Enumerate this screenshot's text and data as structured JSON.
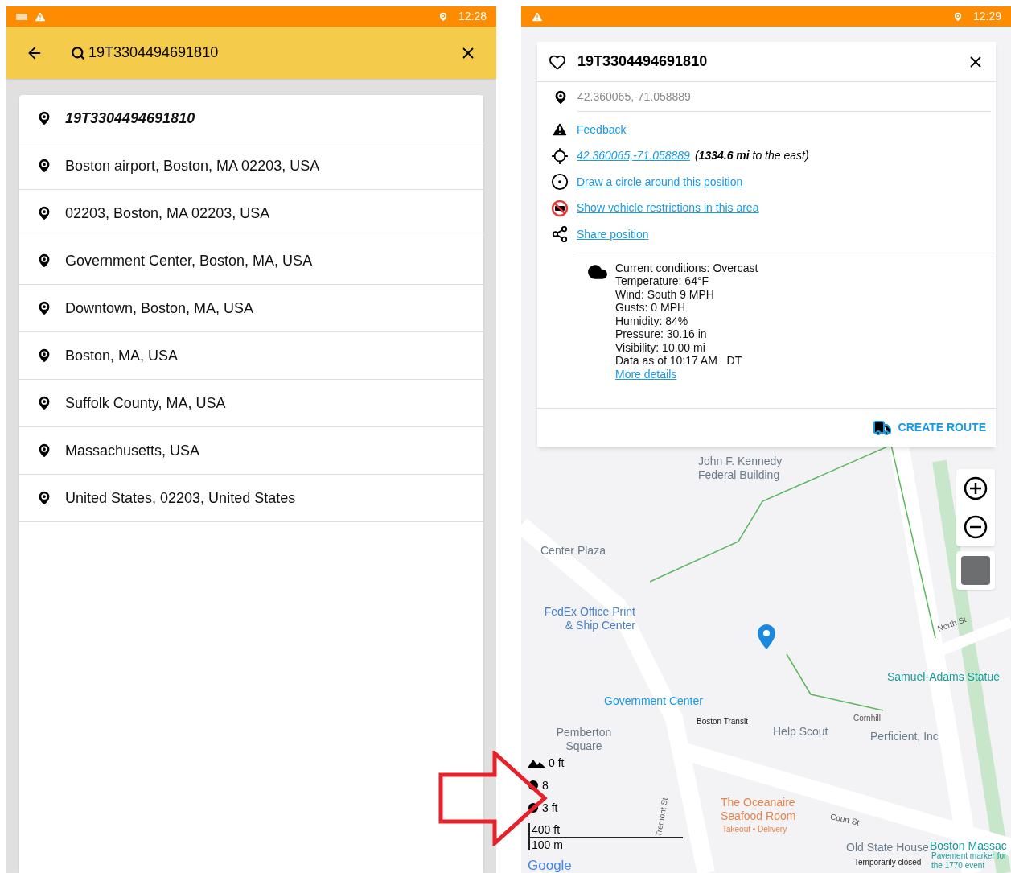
{
  "left_screen": {
    "status_bar": {
      "time": "12:28"
    },
    "search": {
      "value": "19T3304494691810"
    },
    "results": [
      {
        "label": "19T3304494691810",
        "selected": true
      },
      {
        "label": "Boston airport, Boston, MA 02203, USA",
        "selected": false
      },
      {
        "label": "02203, Boston, MA 02203, USA",
        "selected": false
      },
      {
        "label": "Government Center, Boston, MA, USA",
        "selected": false
      },
      {
        "label": "Downtown, Boston, MA, USA",
        "selected": false
      },
      {
        "label": "Boston, MA, USA",
        "selected": false
      },
      {
        "label": "Suffolk County, MA, USA",
        "selected": false
      },
      {
        "label": "Massachusetts, USA",
        "selected": false
      },
      {
        "label": "United States, 02203, United States",
        "selected": false
      }
    ]
  },
  "right_screen": {
    "status_bar": {
      "time": "12:29"
    },
    "popup": {
      "title": "19T3304494691810",
      "coordinates": "42.360065,-71.058889",
      "actions": [
        {
          "kind": "feedback",
          "label": "Feedback"
        },
        {
          "kind": "distance",
          "label": "42.360065,-71.058889",
          "note": "(**1334.6 mi** to the east)"
        },
        {
          "kind": "circle",
          "label": "Draw a circle around this position"
        },
        {
          "kind": "restrictions",
          "label": "Show vehicle restrictions in this area"
        },
        {
          "kind": "share",
          "label": "Share position"
        }
      ],
      "weather": {
        "lines": [
          "Current conditions: Overcast",
          "Temperature: 64°F",
          "Wind: South 9 MPH",
          "Gusts: 0 MPH",
          "Humidity: 84%",
          "Pressure: 30.16 in",
          "Visibility: 10.00 mi",
          "Data as of 10:17 AM   DT"
        ],
        "link": "More details"
      },
      "create_route": "CREATE ROUTE"
    },
    "map_labels": [
      {
        "text": "John F. Kennedy Federal Building",
        "kind": "building"
      },
      {
        "text": "Center Plaza",
        "kind": "building"
      },
      {
        "text": "FedEx Office Print & Ship Center",
        "kind": "shop"
      },
      {
        "text": "North St",
        "kind": "street"
      },
      {
        "text": "Samuel-Adams Statue",
        "kind": "sight"
      },
      {
        "text": "Government Center",
        "kind": "transit"
      },
      {
        "text": "Boston Transit",
        "kind": "small"
      },
      {
        "text": "Pemberton Square",
        "kind": "building"
      },
      {
        "text": "Help Scout",
        "kind": "building"
      },
      {
        "text": "Cornhill",
        "kind": "street"
      },
      {
        "text": "Perficient, Inc",
        "kind": "building"
      },
      {
        "text": "Tremont St",
        "kind": "street"
      },
      {
        "text": "The Oceanaire Seafood Room",
        "kind": "food"
      },
      {
        "text": "Takeout • Delivery",
        "kind": "food_small"
      },
      {
        "text": "Court St",
        "kind": "street"
      },
      {
        "text": "Old State House",
        "kind": "building"
      },
      {
        "text": "Temporarily closed",
        "kind": "small"
      },
      {
        "text": "Boston Massac",
        "kind": "sight"
      },
      {
        "text": "Pavement marker for the 1770 event",
        "kind": "sight_small"
      }
    ],
    "elevation": [
      "0 ft",
      "8",
      "3 ft"
    ],
    "scale": [
      "400 ft",
      "100 m"
    ],
    "map_logo": "Google"
  }
}
